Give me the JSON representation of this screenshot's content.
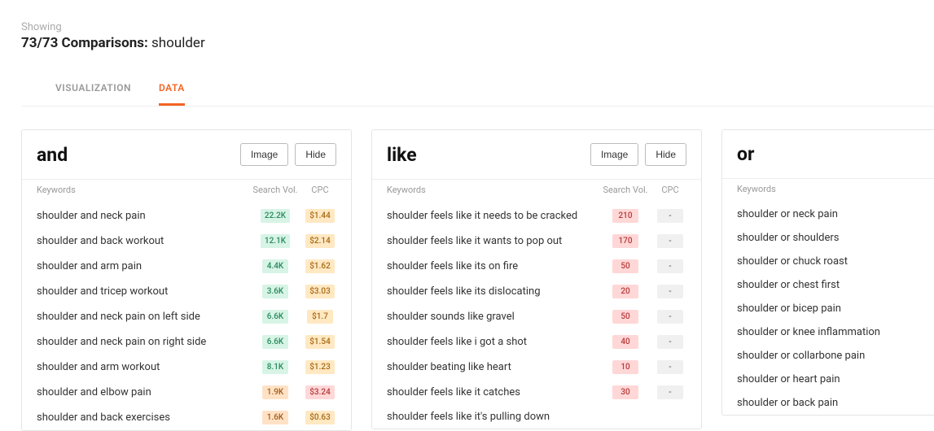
{
  "header": {
    "showing": "Showing",
    "count": "73/73 Comparisons:",
    "keyword": "shoulder"
  },
  "tabs": {
    "visualization": "VISUALIZATION",
    "data": "DATA"
  },
  "buttons": {
    "image": "Image",
    "hide": "Hide"
  },
  "columns": {
    "keywords": "Keywords",
    "vol": "Search Vol.",
    "cpc": "CPC"
  },
  "cards": {
    "and": {
      "title": "and",
      "rows": [
        {
          "kw": "shoulder and neck pain",
          "vol": "22.2K",
          "volc": "vol-green",
          "cpc": "$1.44",
          "cpcc": "cpc-orange"
        },
        {
          "kw": "shoulder and back workout",
          "vol": "12.1K",
          "volc": "vol-green",
          "cpc": "$2.14",
          "cpcc": "cpc-orange"
        },
        {
          "kw": "shoulder and arm pain",
          "vol": "4.4K",
          "volc": "vol-green",
          "cpc": "$1.62",
          "cpcc": "cpc-orange"
        },
        {
          "kw": "shoulder and tricep workout",
          "vol": "3.6K",
          "volc": "vol-green",
          "cpc": "$3.03",
          "cpcc": "cpc-orange"
        },
        {
          "kw": "shoulder and neck pain on left side",
          "vol": "6.6K",
          "volc": "vol-green",
          "cpc": "$1.7",
          "cpcc": "cpc-orange"
        },
        {
          "kw": "shoulder and neck pain on right side",
          "vol": "6.6K",
          "volc": "vol-green",
          "cpc": "$1.54",
          "cpcc": "cpc-orange"
        },
        {
          "kw": "shoulder and arm workout",
          "vol": "8.1K",
          "volc": "vol-green",
          "cpc": "$1.23",
          "cpcc": "cpc-orange"
        },
        {
          "kw": "shoulder and elbow pain",
          "vol": "1.9K",
          "volc": "vol-orange",
          "cpc": "$3.24",
          "cpcc": "cpc-red"
        },
        {
          "kw": "shoulder and back exercises",
          "vol": "1.6K",
          "volc": "vol-orange",
          "cpc": "$0.63",
          "cpcc": "cpc-orange"
        }
      ]
    },
    "like": {
      "title": "like",
      "rows": [
        {
          "kw": "shoulder feels like it needs to be cracked",
          "vol": "210",
          "volc": "vol-red",
          "cpc": "-",
          "cpcc": "cpc-gray"
        },
        {
          "kw": "shoulder feels like it wants to pop out",
          "vol": "170",
          "volc": "vol-red",
          "cpc": "-",
          "cpcc": "cpc-gray"
        },
        {
          "kw": "shoulder feels like its on fire",
          "vol": "50",
          "volc": "vol-red",
          "cpc": "-",
          "cpcc": "cpc-gray"
        },
        {
          "kw": "shoulder feels like its dislocating",
          "vol": "20",
          "volc": "vol-red",
          "cpc": "-",
          "cpcc": "cpc-gray"
        },
        {
          "kw": "shoulder sounds like gravel",
          "vol": "50",
          "volc": "vol-red",
          "cpc": "-",
          "cpcc": "cpc-gray"
        },
        {
          "kw": "shoulder feels like i got a shot",
          "vol": "40",
          "volc": "vol-red",
          "cpc": "-",
          "cpcc": "cpc-gray"
        },
        {
          "kw": "shoulder beating like heart",
          "vol": "10",
          "volc": "vol-red",
          "cpc": "-",
          "cpcc": "cpc-gray"
        },
        {
          "kw": "shoulder feels like it catches",
          "vol": "30",
          "volc": "vol-red",
          "cpc": "-",
          "cpcc": "cpc-gray"
        },
        {
          "kw": "shoulder feels like it's pulling down",
          "vol": "",
          "volc": "",
          "cpc": "",
          "cpcc": ""
        }
      ]
    },
    "or": {
      "title": "or",
      "rows": [
        {
          "kw": "shoulder or neck pain"
        },
        {
          "kw": "shoulder or shoulders"
        },
        {
          "kw": "shoulder or chuck roast"
        },
        {
          "kw": "shoulder or chest first"
        },
        {
          "kw": "shoulder or bicep pain"
        },
        {
          "kw": "shoulder or knee inflammation"
        },
        {
          "kw": "shoulder or collarbone pain"
        },
        {
          "kw": "shoulder or heart pain"
        },
        {
          "kw": "shoulder or back pain"
        }
      ]
    }
  }
}
